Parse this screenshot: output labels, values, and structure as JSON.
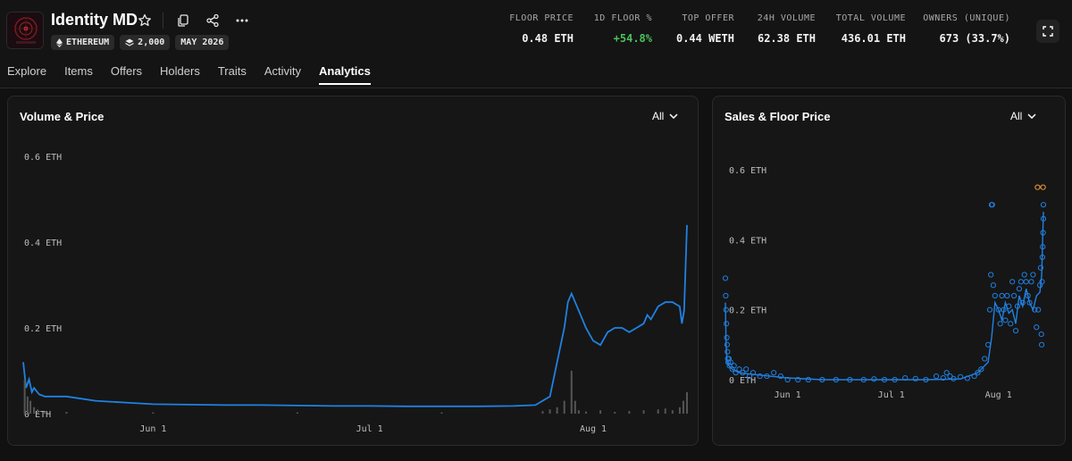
{
  "collection": {
    "title": "Identity MD",
    "chain": "ETHEREUM",
    "items": "2,000",
    "date": "MAY 2026"
  },
  "stats": [
    {
      "label": "FLOOR PRICE",
      "value": "0.48 ETH",
      "color": "#f2f2f2"
    },
    {
      "label": "1D FLOOR %",
      "value": "+54.8%",
      "color": "#4cc05c"
    },
    {
      "label": "TOP OFFER",
      "value": "0.44 WETH",
      "color": "#f2f2f2"
    },
    {
      "label": "24H VOLUME",
      "value": "62.38 ETH",
      "color": "#f2f2f2"
    },
    {
      "label": "TOTAL VOLUME",
      "value": "436.01 ETH",
      "color": "#f2f2f2"
    },
    {
      "label": "OWNERS (UNIQUE)",
      "value": "673 (33.7%)",
      "color": "#f2f2f2"
    }
  ],
  "tabs": [
    "Explore",
    "Items",
    "Offers",
    "Holders",
    "Traits",
    "Activity",
    "Analytics"
  ],
  "active_tab": "Analytics",
  "icons": {
    "star": "star-icon",
    "copy": "copy-icon",
    "share": "share-icon",
    "more": "more-icon",
    "expand": "expand-icon",
    "chevron": "chevron-down-icon"
  },
  "colors": {
    "accent": "#2081e2",
    "volume": "#555555",
    "orange": "#f0a030",
    "positive": "#4cc05c"
  },
  "volume_panel": {
    "title": "Volume & Price",
    "range": "All"
  },
  "sales_panel": {
    "title": "Sales & Floor Price",
    "range": "All"
  },
  "chart_data": [
    {
      "type": "line",
      "title": "Volume & Price",
      "y_unit": "ETH",
      "y_ticks": [
        "0.6 ETH",
        "0.4 ETH",
        "0.2 ETH",
        "0 ETH"
      ],
      "y_tick_values": [
        0.6,
        0.4,
        0.2,
        0
      ],
      "ylim": [
        0,
        0.6
      ],
      "x_ticks": [
        "Jun 1",
        "Jul 1",
        "Aug 1"
      ],
      "x_tick_days": [
        0,
        30,
        61
      ],
      "xlim_days": [
        -18,
        74
      ],
      "grid": false,
      "series": [
        {
          "kind": "price-line",
          "points": [
            [
              -18,
              0.12
            ],
            [
              -17.6,
              0.06
            ],
            [
              -17.2,
              0.08
            ],
            [
              -16.8,
              0.05
            ],
            [
              -16.5,
              0.06
            ],
            [
              -15.8,
              0.045
            ],
            [
              -15,
              0.04
            ],
            [
              -14,
              0.04
            ],
            [
              -12,
              0.04
            ],
            [
              -10,
              0.035
            ],
            [
              -8,
              0.03
            ],
            [
              -6,
              0.028
            ],
            [
              -3,
              0.025
            ],
            [
              0,
              0.022
            ],
            [
              5,
              0.021
            ],
            [
              10,
              0.02
            ],
            [
              15,
              0.02
            ],
            [
              20,
              0.019
            ],
            [
              25,
              0.018
            ],
            [
              30,
              0.018
            ],
            [
              35,
              0.017
            ],
            [
              40,
              0.017
            ],
            [
              45,
              0.017
            ],
            [
              50,
              0.018
            ],
            [
              53,
              0.02
            ],
            [
              55,
              0.04
            ],
            [
              56,
              0.12
            ],
            [
              57,
              0.2
            ],
            [
              57.5,
              0.26
            ],
            [
              58,
              0.28
            ],
            [
              58.5,
              0.26
            ],
            [
              59,
              0.24
            ],
            [
              60,
              0.2
            ],
            [
              61,
              0.17
            ],
            [
              62,
              0.16
            ],
            [
              63,
              0.19
            ],
            [
              64,
              0.2
            ],
            [
              65,
              0.2
            ],
            [
              66,
              0.19
            ],
            [
              67,
              0.2
            ],
            [
              68,
              0.21
            ],
            [
              68.5,
              0.23
            ],
            [
              69,
              0.22
            ],
            [
              70,
              0.25
            ],
            [
              71,
              0.26
            ],
            [
              72,
              0.26
            ],
            [
              73,
              0.25
            ],
            [
              73.3,
              0.21
            ],
            [
              73.6,
              0.24
            ],
            [
              74,
              0.44
            ]
          ]
        },
        {
          "kind": "volume-bars",
          "points": [
            [
              -17.8,
              0.08
            ],
            [
              -17.4,
              0.04
            ],
            [
              -17,
              0.03
            ],
            [
              -16.5,
              0.015
            ],
            [
              -16,
              0.01
            ],
            [
              -15,
              0.005
            ],
            [
              -12,
              0.004
            ],
            [
              0,
              0.003
            ],
            [
              20,
              0.003
            ],
            [
              40,
              0.003
            ],
            [
              54,
              0.006
            ],
            [
              55,
              0.01
            ],
            [
              56,
              0.015
            ],
            [
              57,
              0.03
            ],
            [
              58,
              0.1
            ],
            [
              58.5,
              0.03
            ],
            [
              59,
              0.008
            ],
            [
              60,
              0.005
            ],
            [
              62,
              0.008
            ],
            [
              64,
              0.004
            ],
            [
              66,
              0.006
            ],
            [
              68,
              0.008
            ],
            [
              70,
              0.01
            ],
            [
              71,
              0.012
            ],
            [
              72,
              0.008
            ],
            [
              73,
              0.015
            ],
            [
              73.5,
              0.03
            ],
            [
              74,
              0.05
            ]
          ]
        }
      ]
    },
    {
      "type": "scatter",
      "title": "Sales & Floor Price",
      "y_unit": "ETH",
      "y_ticks": [
        "0.6 ETH",
        "0.4 ETH",
        "0.2 ETH",
        "0 ETH"
      ],
      "y_tick_values": [
        0.6,
        0.4,
        0.2,
        0
      ],
      "ylim": [
        0,
        0.6
      ],
      "x_ticks": [
        "Jun 1",
        "Jul 1",
        "Aug 1"
      ],
      "x_tick_days": [
        0,
        30,
        61
      ],
      "xlim_days": [
        -18,
        74
      ],
      "grid": false,
      "series": [
        {
          "kind": "floor-line",
          "points": [
            [
              -18,
              0.22
            ],
            [
              -17.8,
              0.1
            ],
            [
              -17.5,
              0.05
            ],
            [
              -17,
              0.04
            ],
            [
              -16,
              0.03
            ],
            [
              -14,
              0.02
            ],
            [
              -10,
              0.015
            ],
            [
              -5,
              0.01
            ],
            [
              0,
              0.005
            ],
            [
              10,
              0
            ],
            [
              20,
              0
            ],
            [
              30,
              0
            ],
            [
              40,
              0
            ],
            [
              50,
              0.002
            ],
            [
              55,
              0.02
            ],
            [
              58,
              0.05
            ],
            [
              59,
              0.12
            ],
            [
              60,
              0.22
            ],
            [
              61,
              0.2
            ],
            [
              62,
              0.17
            ],
            [
              63,
              0.22
            ],
            [
              64,
              0.19
            ],
            [
              65,
              0.2
            ],
            [
              66,
              0.16
            ],
            [
              67,
              0.24
            ],
            [
              68,
              0.21
            ],
            [
              69,
              0.26
            ],
            [
              70,
              0.22
            ],
            [
              71,
              0.2
            ],
            [
              72,
              0.24
            ],
            [
              73,
              0.25
            ],
            [
              73.5,
              0.3
            ],
            [
              74,
              0.48
            ]
          ]
        },
        {
          "kind": "sales",
          "points": [
            [
              -18,
              0.29
            ],
            [
              -17.9,
              0.24
            ],
            [
              -17.8,
              0.2
            ],
            [
              -17.7,
              0.16
            ],
            [
              -17.6,
              0.12
            ],
            [
              -17.5,
              0.1
            ],
            [
              -17.4,
              0.08
            ],
            [
              -17.3,
              0.06
            ],
            [
              -17.2,
              0.05
            ],
            [
              -17,
              0.06
            ],
            [
              -16.8,
              0.04
            ],
            [
              -16.5,
              0.05
            ],
            [
              -16,
              0.03
            ],
            [
              -15.5,
              0.04
            ],
            [
              -15,
              0.02
            ],
            [
              -14,
              0.03
            ],
            [
              -13,
              0.02
            ],
            [
              -12,
              0.03
            ],
            [
              -11,
              0.01
            ],
            [
              -10,
              0.02
            ],
            [
              -8,
              0.01
            ],
            [
              -6,
              0.01
            ],
            [
              -4,
              0.02
            ],
            [
              -2,
              0.01
            ],
            [
              0,
              0
            ],
            [
              3,
              0
            ],
            [
              6,
              0
            ],
            [
              10,
              0
            ],
            [
              14,
              0
            ],
            [
              18,
              0
            ],
            [
              22,
              0
            ],
            [
              25,
              0.002
            ],
            [
              28,
              0
            ],
            [
              31,
              0
            ],
            [
              34,
              0.005
            ],
            [
              37,
              0.003
            ],
            [
              40,
              0
            ],
            [
              43,
              0.01
            ],
            [
              45,
              0.005
            ],
            [
              46,
              0.02
            ],
            [
              47,
              0.01
            ],
            [
              48,
              0.003
            ],
            [
              50,
              0.008
            ],
            [
              52,
              0.004
            ],
            [
              54,
              0.01
            ],
            [
              55,
              0.02
            ],
            [
              56,
              0.03
            ],
            [
              57,
              0.06
            ],
            [
              58,
              0.1
            ],
            [
              58.5,
              0.2
            ],
            [
              58.8,
              0.3
            ],
            [
              59,
              0.5
            ],
            [
              59.2,
              0.5
            ],
            [
              59.5,
              0.27
            ],
            [
              60,
              0.24
            ],
            [
              61,
              0.2
            ],
            [
              61.5,
              0.16
            ],
            [
              62,
              0.24
            ],
            [
              62.5,
              0.2
            ],
            [
              63,
              0.17
            ],
            [
              63.5,
              0.24
            ],
            [
              64,
              0.21
            ],
            [
              64.5,
              0.16
            ],
            [
              65,
              0.28
            ],
            [
              65.5,
              0.24
            ],
            [
              66,
              0.14
            ],
            [
              66.5,
              0.21
            ],
            [
              67,
              0.26
            ],
            [
              67.5,
              0.28
            ],
            [
              68,
              0.22
            ],
            [
              68.5,
              0.3
            ],
            [
              69,
              0.28
            ],
            [
              69.5,
              0.24
            ],
            [
              70,
              0.22
            ],
            [
              70.5,
              0.28
            ],
            [
              71,
              0.3
            ],
            [
              71.5,
              0.2
            ],
            [
              72,
              0.15
            ],
            [
              72.5,
              0.2
            ],
            [
              73,
              0.27
            ],
            [
              73.2,
              0.32
            ],
            [
              73.4,
              0.13
            ],
            [
              73.5,
              0.1
            ],
            [
              73.6,
              0.28
            ],
            [
              73.8,
              0.38
            ],
            [
              74,
              0.5
            ],
            [
              74,
              0.46
            ],
            [
              73.9,
              0.42
            ],
            [
              73.7,
              0.35
            ]
          ]
        },
        {
          "kind": "highlight-sales",
          "points": [
            [
              72.3,
              0.55
            ],
            [
              73.9,
              0.55
            ]
          ]
        }
      ]
    }
  ]
}
